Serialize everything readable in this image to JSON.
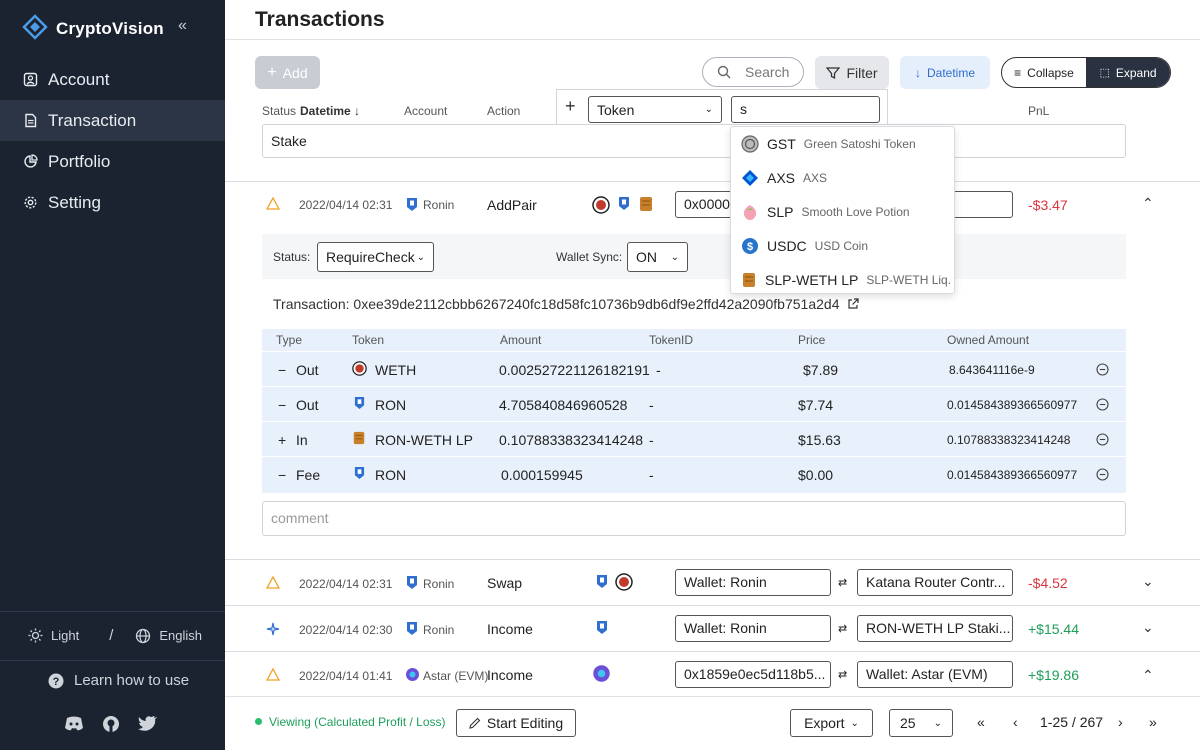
{
  "app": {
    "name": "CryptoVision"
  },
  "sidebar": {
    "items": [
      {
        "label": "Account",
        "icon": "user-icon"
      },
      {
        "label": "Transaction",
        "icon": "document-icon",
        "active": true
      },
      {
        "label": "Portfolio",
        "icon": "pie-chart-icon"
      },
      {
        "label": "Setting",
        "icon": "gear-icon"
      }
    ],
    "theme_label": "Light",
    "separator": "/",
    "language_label": "English",
    "help_label": "Learn how to use"
  },
  "header": {
    "title": "Transactions"
  },
  "toolbar": {
    "add_label": "Add",
    "search_placeholder": "Search",
    "filter_label": "Filter",
    "datetime_label": "Datetime",
    "collapse_label": "Collapse",
    "expand_label": "Expand"
  },
  "columns": {
    "status": "Status",
    "datetime": "Datetime",
    "account": "Account",
    "action": "Action",
    "pnl": "PnL"
  },
  "filter": {
    "field": "Token",
    "query": "s",
    "options": [
      {
        "symbol": "GST",
        "name": "Green Satoshi Token"
      },
      {
        "symbol": "AXS",
        "name": "AXS"
      },
      {
        "symbol": "SLP",
        "name": "Smooth Love Potion"
      },
      {
        "symbol": "USDC",
        "name": "USD Coin"
      },
      {
        "symbol": "SLP-WETH LP",
        "name": "SLP-WETH Liq..."
      }
    ]
  },
  "top_comment": "Stake",
  "expanded": {
    "datetime": "2022/04/14 02:31",
    "account": "Ronin",
    "action": "AddPair",
    "from": "0x00000",
    "pnl": "-$3.47",
    "status_label": "Status:",
    "status_value": "RequireCheck",
    "wallet_sync_label": "Wallet Sync:",
    "wallet_sync_value": "ON",
    "transaction_label": "Transaction: 0xee39de2112cbbb6267240fc18d58fc10736b9db6df9e2ffd42a2090fb751a2d4",
    "table_headers": {
      "type": "Type",
      "token": "Token",
      "amount": "Amount",
      "tokenid": "TokenID",
      "price": "Price",
      "owned": "Owned Amount"
    },
    "rows": [
      {
        "sign": "−",
        "type": "Out",
        "token": "WETH",
        "amount": "0.002527221126182191",
        "tokenid": "-",
        "price": "$7.89",
        "owned": "8.643641116e-9"
      },
      {
        "sign": "−",
        "type": "Out",
        "token": "RON",
        "amount": "4.705840846960528",
        "tokenid": "-",
        "price": "$7.74",
        "owned": "0.014584389366560977"
      },
      {
        "sign": "+",
        "type": "In",
        "token": "RON-WETH LP",
        "amount": "0.10788338323414248",
        "tokenid": "-",
        "price": "$15.63",
        "owned": "0.10788338323414248"
      },
      {
        "sign": "−",
        "type": "Fee",
        "token": "RON",
        "amount": "0.000159945",
        "tokenid": "-",
        "price": "$0.00",
        "owned": "0.014584389366560977"
      }
    ],
    "comment_placeholder": "comment"
  },
  "transactions": [
    {
      "datetime": "2022/04/14 02:31",
      "account": "Ronin",
      "action": "Swap",
      "from": "Wallet: Ronin",
      "to": "Katana Router Contr...",
      "pnl": "-$4.52"
    },
    {
      "datetime": "2022/04/14 02:30",
      "account": "Ronin",
      "action": "Income",
      "from": "Wallet: Ronin",
      "to": "RON-WETH LP Staki...",
      "pnl": "+$15.44"
    },
    {
      "datetime": "2022/04/14 01:41",
      "account": "Astar (EVM)",
      "action": "Income",
      "from": "0x1859e0ec5d118b5...",
      "to": "Wallet: Astar (EVM)",
      "pnl": "+$19.86"
    }
  ],
  "footer": {
    "status": "Viewing (Calculated Profit / Loss)",
    "start_editing": "Start Editing",
    "export": "Export",
    "page_size": "25",
    "range": "1-25 / 267"
  },
  "colors": {
    "sidebar_bg": "#1b2331",
    "accent_blue": "#2f6fd0",
    "negative": "#d9363e",
    "positive": "#1e9e5a",
    "table_bg": "#e8f0fb"
  }
}
